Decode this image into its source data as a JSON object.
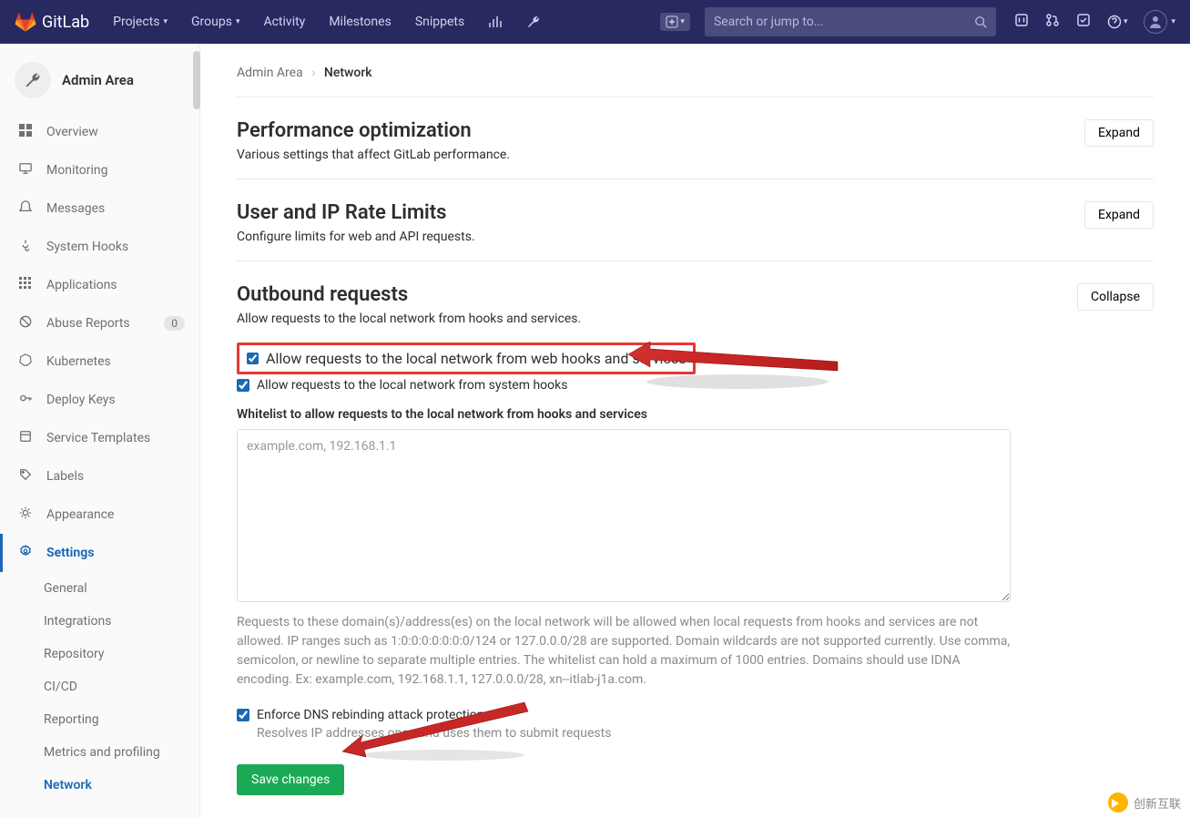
{
  "nav": {
    "brand": "GitLab",
    "items": [
      "Projects",
      "Groups",
      "Activity",
      "Milestones",
      "Snippets"
    ],
    "search_placeholder": "Search or jump to..."
  },
  "sidebar": {
    "title": "Admin Area",
    "items": [
      {
        "icon": "overview",
        "label": "Overview"
      },
      {
        "icon": "monitor",
        "label": "Monitoring"
      },
      {
        "icon": "messages",
        "label": "Messages"
      },
      {
        "icon": "hook",
        "label": "System Hooks"
      },
      {
        "icon": "apps",
        "label": "Applications"
      },
      {
        "icon": "abuse",
        "label": "Abuse Reports",
        "badge": "0"
      },
      {
        "icon": "k8s",
        "label": "Kubernetes"
      },
      {
        "icon": "key",
        "label": "Deploy Keys"
      },
      {
        "icon": "templates",
        "label": "Service Templates"
      },
      {
        "icon": "labels",
        "label": "Labels"
      },
      {
        "icon": "appearance",
        "label": "Appearance"
      },
      {
        "icon": "settings",
        "label": "Settings",
        "active": true
      }
    ],
    "subitems": [
      "General",
      "Integrations",
      "Repository",
      "CI/CD",
      "Reporting",
      "Metrics and profiling",
      "Network"
    ]
  },
  "breadcrumb": {
    "root": "Admin Area",
    "current": "Network"
  },
  "sections": {
    "perf": {
      "title": "Performance optimization",
      "desc": "Various settings that affect GitLab performance.",
      "btn": "Expand"
    },
    "rate": {
      "title": "User and IP Rate Limits",
      "desc": "Configure limits for web and API requests.",
      "btn": "Expand"
    },
    "outbound": {
      "title": "Outbound requests",
      "desc": "Allow requests to the local network from hooks and services.",
      "btn": "Collapse",
      "check1": "Allow requests to the local network from web hooks and services",
      "check2": "Allow requests to the local network from system hooks",
      "whitelist_label": "Whitelist to allow requests to the local network from hooks and services",
      "whitelist_placeholder": "example.com, 192.168.1.1",
      "help": "Requests to these domain(s)/address(es) on the local network will be allowed when local requests from hooks and services are not allowed. IP ranges such as 1:0:0:0:0:0:0:0/124 or 127.0.0.0/28 are supported. Domain wildcards are not supported currently. Use comma, semicolon, or newline to separate multiple entries. The whitelist can hold a maximum of 1000 entries. Domains should use IDNA encoding. Ex: example.com, 192.168.1.1, 127.0.0.0/28, xn--itlab-j1a.com.",
      "check3": "Enforce DNS rebinding attack protection",
      "check3_help": "Resolves IP addresses once and uses them to submit requests",
      "save": "Save changes"
    }
  },
  "watermark": "创新互联"
}
